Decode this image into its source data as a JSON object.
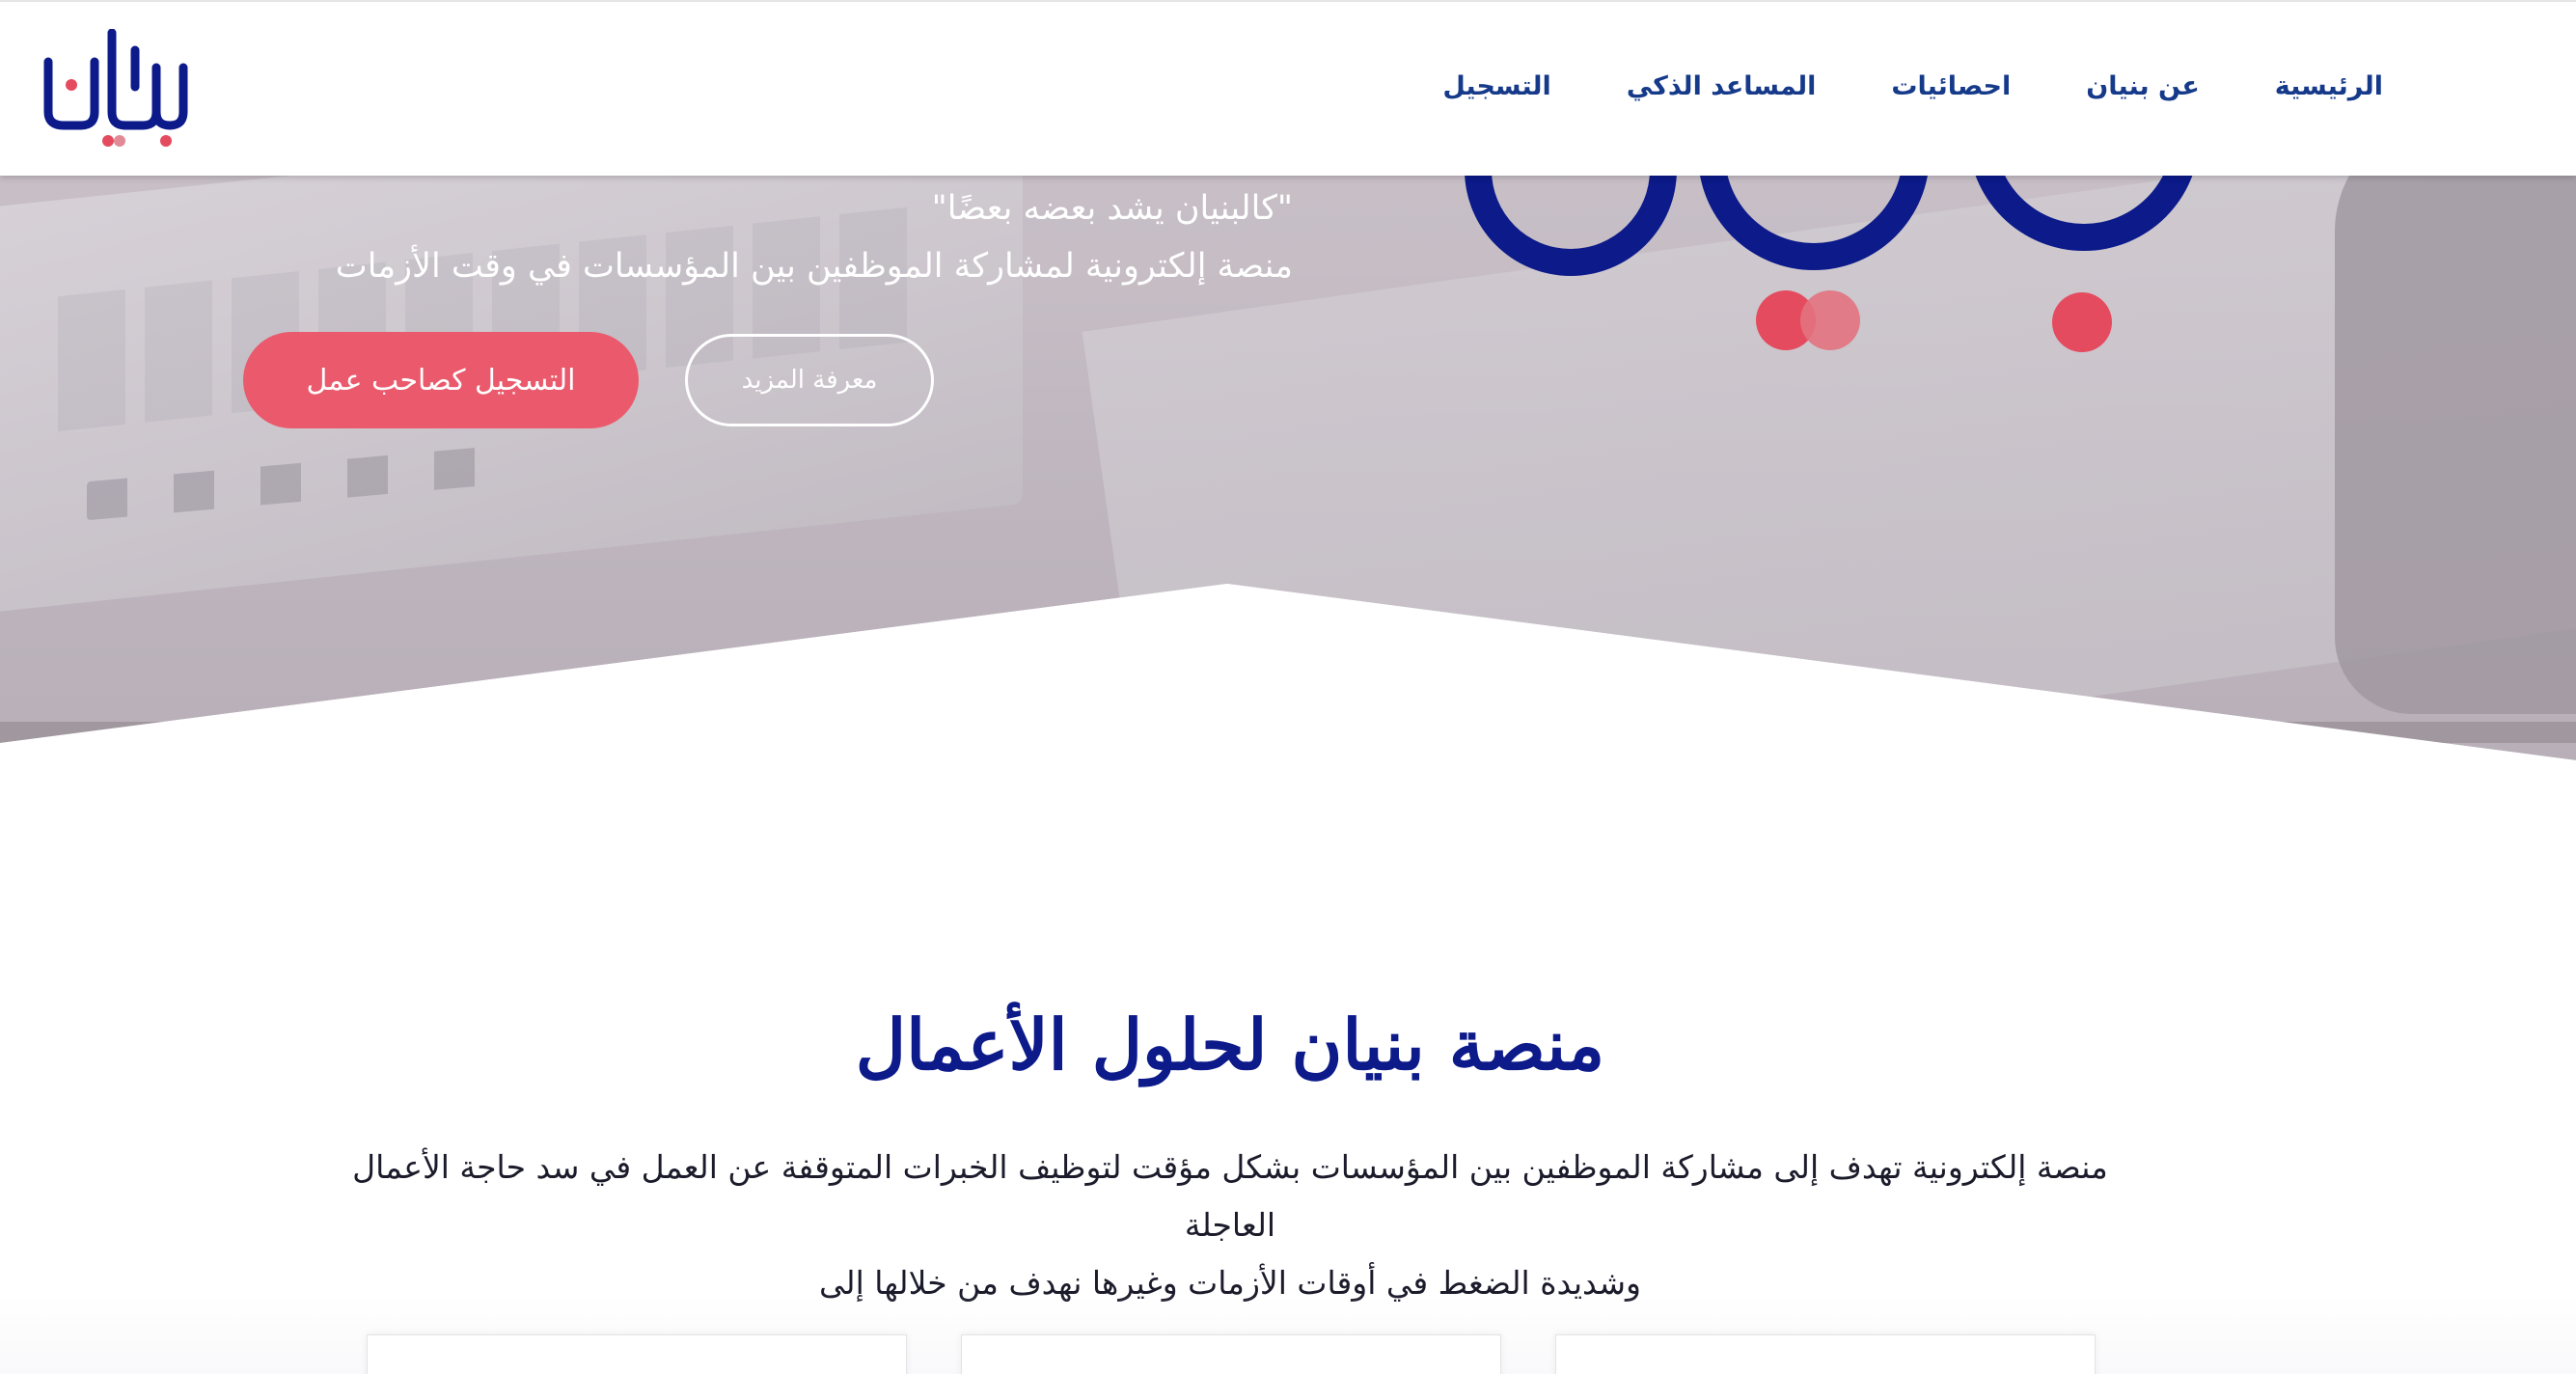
{
  "brand": {
    "logo_text": "بنيان",
    "colors": {
      "primary": "#0c1a8a",
      "accent": "#e54b5f",
      "nav": "#163a8a"
    }
  },
  "nav": {
    "items": [
      {
        "label": "الرئيسية"
      },
      {
        "label": "عن بنيان"
      },
      {
        "label": "احصائيات"
      },
      {
        "label": "المساعد الذكي"
      },
      {
        "label": "التسجيل"
      }
    ]
  },
  "hero": {
    "quote": "\"كالبنيان يشد بعضه بعضًا\"",
    "subtitle": "منصة إلكترونية لمشاركة الموظفين بين المؤسسات في وقت الأزمات",
    "register_button": "التسجيل كصاحب عمل",
    "more_button": "معرفة المزيد"
  },
  "section": {
    "title": "منصة بنيان لحلول الأعمال",
    "description_line1": "منصة إلكترونية تهدف إلى مشاركة الموظفين بين المؤسسات بشكل مؤقت لتوظيف الخبرات المتوقفة عن العمل في سد حاجة الأعمال العاجلة",
    "description_line2": "وشديدة الضغط في أوقات الأزمات وغيرها نهدف من خلالها إلى"
  }
}
